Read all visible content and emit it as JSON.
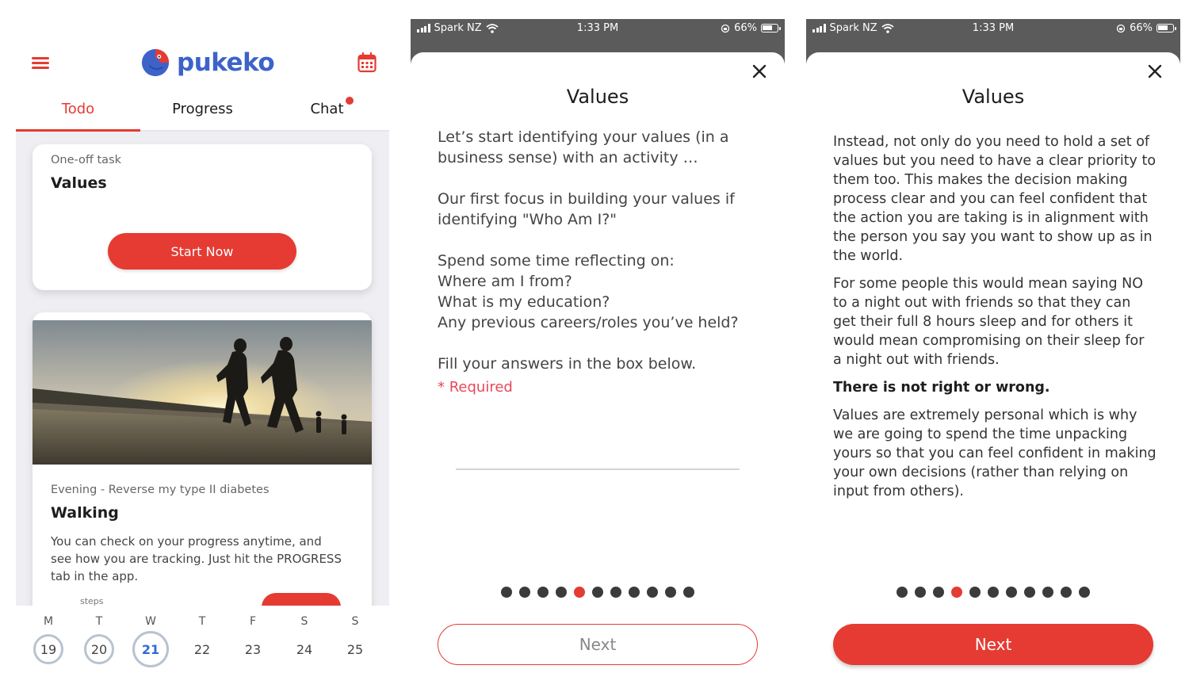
{
  "screen1": {
    "app_name": "pukeko",
    "tabs": [
      {
        "label": "Todo",
        "active": true
      },
      {
        "label": "Progress",
        "active": false
      },
      {
        "label": "Chat",
        "active": false,
        "badge": true
      }
    ],
    "task_card": {
      "type_label": "One-off task",
      "title": "Values",
      "button_label": "Start Now"
    },
    "activity_card": {
      "subtitle": "Evening - Reverse my type II diabetes",
      "title": "Walking",
      "description": "You can check on your progress anytime, and see how you are tracking. Just hit the PROGRESS tab in the app.",
      "steps_label": "steps"
    },
    "week": [
      {
        "letter": "M",
        "date": "19",
        "state": "done"
      },
      {
        "letter": "T",
        "date": "20",
        "state": "done"
      },
      {
        "letter": "W",
        "date": "21",
        "state": "today"
      },
      {
        "letter": "T",
        "date": "22",
        "state": "future"
      },
      {
        "letter": "F",
        "date": "23",
        "state": "future"
      },
      {
        "letter": "S",
        "date": "24",
        "state": "future"
      },
      {
        "letter": "S",
        "date": "25",
        "state": "future"
      }
    ],
    "colors": {
      "accent": "#e53b33",
      "brand": "#3d63c9",
      "today": "#2f6ad6"
    }
  },
  "status_bar": {
    "carrier": "Spark NZ",
    "time": "1:33 PM",
    "battery": "66%"
  },
  "screen2": {
    "title": "Values",
    "paragraphs": [
      "Let’s start identifying your values (in a business sense) with an activity …",
      "Our first focus in building your values if identifying \"Who Am I?\"",
      "Spend some time reflecting on:\nWhere am I from?\nWhat is my education?\nAny previous careers/roles you’ve held?",
      "Fill your answers in the box below."
    ],
    "required_label": "* Required",
    "answer_value": "",
    "pager": {
      "total": 11,
      "current": 5
    },
    "next_label": "Next",
    "next_enabled": false
  },
  "screen3": {
    "title": "Values",
    "paragraphs": [
      "Instead, not only do you need to hold a set of values but you need to have a clear priority to them too. This makes the decision making process clear and you can feel confident that the action you are taking is in alignment with the person you say you want to show up as in the world.",
      "For some people this would mean saying NO to a night out with friends so that they can get their full 8 hours sleep and for others it would mean compromising on their sleep for a night out with friends.",
      "There is not right or wrong.",
      "Values are extremely personal which is why we are going to spend the time unpacking yours so that you can feel confident in making your own decisions (rather than relying on input from others)."
    ],
    "pager": {
      "total": 11,
      "current": 4
    },
    "next_label": "Next",
    "next_enabled": true
  }
}
